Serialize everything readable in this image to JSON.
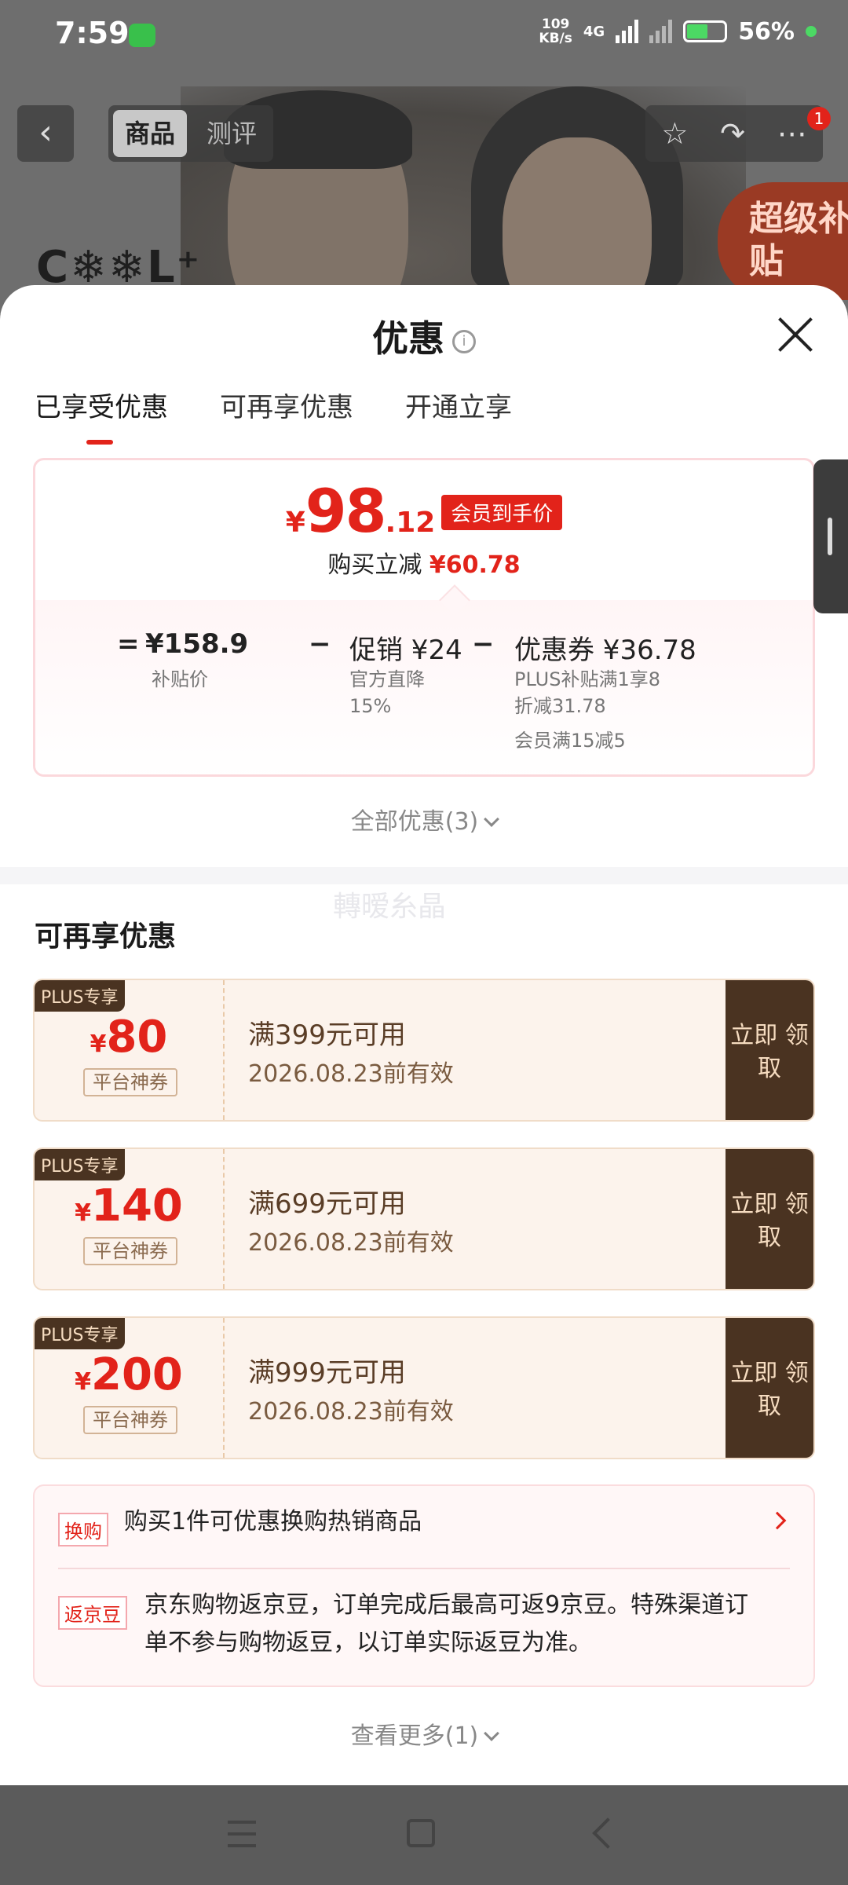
{
  "status_bar": {
    "time": "7:59",
    "net_speed_top": "109",
    "net_speed_bottom": "KB/s",
    "net_type": "4G",
    "battery": "56%"
  },
  "top_nav": {
    "tabs": [
      "商品",
      "测评"
    ],
    "badge": "1"
  },
  "background": {
    "brand": "C❄❄L⁺",
    "subsidy": "超级补贴"
  },
  "sheet": {
    "title": "优惠",
    "tabs": [
      "已享受优惠",
      "可再享优惠",
      "开通立享"
    ],
    "price": {
      "yen": "¥",
      "int": "98",
      "dec": ".12",
      "tag": "会员到手价",
      "reduce_label": "购买立减",
      "reduce_value": "¥60.78"
    },
    "breakdown": {
      "eq": "=",
      "subsidy_price": "¥158.9",
      "subsidy_label": "补贴价",
      "minus1": "−",
      "promo": "促销 ¥24",
      "promo_desc_1": "官方直降",
      "promo_desc_2": "15%",
      "minus2": "−",
      "coupon": "优惠券 ¥36.78",
      "coupon_desc_1": "PLUS补贴满1享8",
      "coupon_desc_2": "折减31.78",
      "coupon_desc_3": "会员满15减5"
    },
    "all_offers": "全部优惠(3)",
    "watermark": "轉暧糸晶",
    "section_title": "可再享优惠",
    "coupons": [
      {
        "plus": "PLUS专享",
        "yen": "¥",
        "amount": "80",
        "kind": "平台神券",
        "condition": "满399元可用",
        "valid": "2026.08.23前有效",
        "claim": "立即 领取"
      },
      {
        "plus": "PLUS专享",
        "yen": "¥",
        "amount": "140",
        "kind": "平台神券",
        "condition": "满699元可用",
        "valid": "2026.08.23前有效",
        "claim": "立即 领取"
      },
      {
        "plus": "PLUS专享",
        "yen": "¥",
        "amount": "200",
        "kind": "平台神券",
        "condition": "满999元可用",
        "valid": "2026.08.23前有效",
        "claim": "立即 领取"
      }
    ],
    "extras": [
      {
        "tag": "换购",
        "text": "购买1件可优惠换购热销商品"
      },
      {
        "tag": "返京豆",
        "text_1": "京东购物返京豆，订单完成后最高可返9京豆。特殊渠道订",
        "text_2": "单不参与购物返豆，以订单实际返豆为准。"
      }
    ],
    "see_more": "查看更多(1)"
  },
  "colors": {
    "accent": "#e2231a",
    "coupon_dark": "#4a3321",
    "coupon_bg": "#fcf3ec"
  }
}
